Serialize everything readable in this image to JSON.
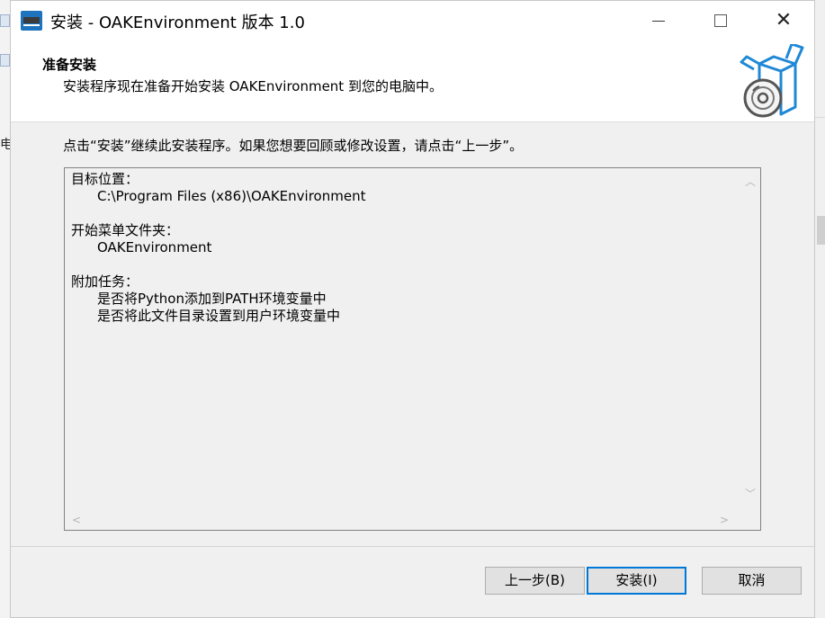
{
  "window": {
    "title": "安装 - OAKEnvironment 版本 1.0",
    "app_icon": "oak-app-icon",
    "controls": [
      "minimize-icon",
      "maximize-icon",
      "close-icon"
    ],
    "close_glyph": "✕"
  },
  "header": {
    "title": "准备安装",
    "subtitle": "安装程序现在准备开始安装 OAKEnvironment 到您的电脑中。",
    "logo": "box-disc-icon"
  },
  "instruction": "点击“安装”继续此安装程序。如果您想要回顾或修改设置，请点击“上一步”。",
  "summary": {
    "dest_label": "目标位置：",
    "dest_value": "C:\\Program Files (x86)\\OAKEnvironment",
    "startmenu_label": "开始菜单文件夹：",
    "startmenu_value": "OAKEnvironment",
    "tasks_label": "附加任务：",
    "task_1": "是否将Python添加到PATH环境变量中",
    "task_2": "是否将此文件目录设置到用户环境变量中"
  },
  "buttons": {
    "back": "上一步(B)",
    "install": "安装(I)",
    "cancel": "取消"
  },
  "background": {
    "left_char": "电"
  },
  "colors": {
    "accent": "#0078d7",
    "logo": "#1e88d6"
  }
}
